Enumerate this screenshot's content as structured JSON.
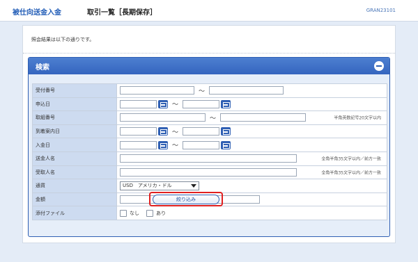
{
  "header": {
    "brand": "被仕向送金入金",
    "title": "取引一覧［長期保存］",
    "screen_id": "GRAN23101"
  },
  "intro": "照会結果は以下の通りです。",
  "search": {
    "title": "検索",
    "rows": {
      "receipt_no": {
        "label": "受付番号"
      },
      "apply_date": {
        "label": "申込日"
      },
      "ref_no": {
        "label": "取組番号",
        "note": "半角英数記号20文字以内"
      },
      "arrival_date": {
        "label": "到着案内日"
      },
      "deposit_date": {
        "label": "入金日"
      },
      "sender": {
        "label": "送金人名",
        "note": "全角半角35文字以内／前方一致"
      },
      "receiver": {
        "label": "受取人名",
        "note": "全角半角35文字以内／前方一致"
      },
      "currency": {
        "label": "通貨",
        "selected": "USD　アメリカ・ドル"
      },
      "amount": {
        "label": "金額"
      },
      "attachment": {
        "label": "添付ファイル",
        "option_none": "なし",
        "option_yes": "あり"
      }
    },
    "tilde": "～",
    "filter_button": "絞り込み"
  },
  "colors": {
    "accent": "#2f5fb3",
    "header_band": "#3565bf",
    "highlight": "#e01f1f",
    "label_bg": "#cddbf0"
  }
}
